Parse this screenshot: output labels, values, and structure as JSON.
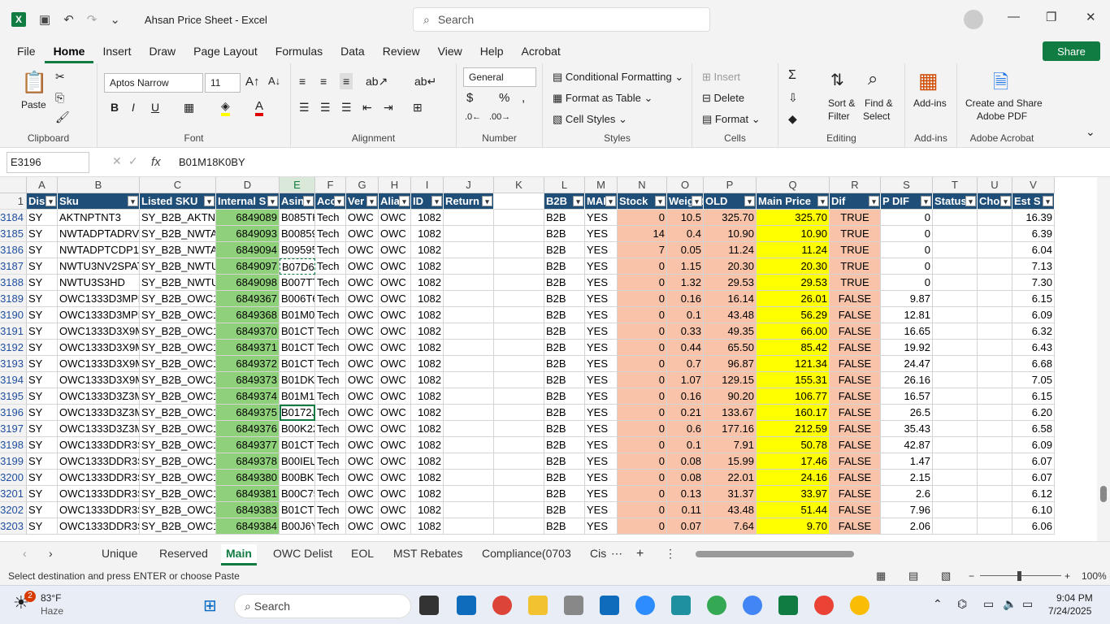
{
  "titlebar": {
    "app_icon": "X",
    "doc_title": "Ahsan Price Sheet  -  Excel",
    "search_placeholder": "Search"
  },
  "menus": [
    "File",
    "Home",
    "Insert",
    "Draw",
    "Page Layout",
    "Formulas",
    "Data",
    "Review",
    "View",
    "Help",
    "Acrobat"
  ],
  "share_label": "Share",
  "ribbon": {
    "clipboard": {
      "label": "Clipboard",
      "paste": "Paste"
    },
    "font": {
      "label": "Font",
      "family": "Aptos Narrow",
      "size": "11"
    },
    "alignment": {
      "label": "Alignment"
    },
    "number": {
      "label": "Number",
      "format": "General"
    },
    "styles": {
      "label": "Styles",
      "cond": "Conditional Formatting",
      "table": "Format as Table",
      "cell": "Cell Styles"
    },
    "cells": {
      "label": "Cells",
      "insert": "Insert",
      "delete": "Delete",
      "format": "Format"
    },
    "editing": {
      "label": "Editing",
      "sort": "Sort &",
      "sort2": "Filter",
      "find": "Find &",
      "find2": "Select"
    },
    "addins": {
      "label": "Add-ins",
      "btn": "Add-ins"
    },
    "acrobat": {
      "label": "Adobe Acrobat",
      "btn1": "Create and Share",
      "btn2": "Adobe PDF"
    }
  },
  "formula": {
    "namebox": "E3196",
    "content": "B01M18K0BY"
  },
  "columns": [
    "A",
    "B",
    "C",
    "D",
    "E",
    "F",
    "G",
    "H",
    "I",
    "J",
    "K",
    "L",
    "M",
    "N",
    "O",
    "P",
    "Q",
    "R",
    "S",
    "T",
    "U",
    "V"
  ],
  "headers": [
    "Dis",
    "Sku",
    "Listed SKU",
    "Internal S",
    "Asin",
    "Acc",
    "Ver",
    "Alia",
    "ID",
    "Return",
    "",
    "B2B",
    "MAP",
    "Stock",
    "Weight",
    "OLD",
    "Main Price",
    "Dif",
    "P DIF",
    "Status",
    "Cho",
    "Est S"
  ],
  "rows": [
    {
      "n": "3184",
      "a": "SY",
      "b": "AKTNPTNT3",
      "c": "SY_B2B_AKTNP",
      "d": "6849089",
      "e": "B085TH",
      "f": "Tech",
      "g": "OWC",
      "h": "OWC",
      "i": "1082",
      "l": "B2B",
      "m": "YES",
      "nn": "0",
      "o": "10.5",
      "p": "325.70",
      "q": "325.70",
      "r": "TRUE",
      "s": "0",
      "v": "16.39"
    },
    {
      "n": "3185",
      "a": "SY",
      "b": "NWTADPTADRV",
      "c": "SY_B2B_NWTAD",
      "d": "6849093",
      "e": "B00859",
      "f": "Tech",
      "g": "OWC",
      "h": "OWC",
      "i": "1082",
      "l": "B2B",
      "m": "YES",
      "nn": "14",
      "o": "0.4",
      "p": "10.90",
      "q": "10.90",
      "r": "TRUE",
      "s": "0",
      "v": "6.39"
    },
    {
      "n": "3186",
      "a": "SY",
      "b": "NWTADPTCDP14",
      "c": "SY_B2B_NWTAD",
      "d": "6849094",
      "e": "B09595",
      "f": "Tech",
      "g": "OWC",
      "h": "OWC",
      "i": "1082",
      "l": "B2B",
      "m": "YES",
      "nn": "7",
      "o": "0.05",
      "p": "11.24",
      "q": "11.24",
      "r": "TRUE",
      "s": "0",
      "v": "6.04"
    },
    {
      "n": "3187",
      "a": "SY",
      "b": "NWTU3NV2SPAT",
      "c": "SY_B2B_NWTU3",
      "d": "6849097",
      "e": "B07D62",
      "f": "Tech",
      "g": "OWC",
      "h": "OWC",
      "i": "1082",
      "l": "B2B",
      "m": "YES",
      "nn": "0",
      "o": "1.15",
      "p": "20.30",
      "q": "20.30",
      "r": "TRUE",
      "s": "0",
      "v": "7.13"
    },
    {
      "n": "3188",
      "a": "SY",
      "b": "NWTU3S3HD",
      "c": "SY_B2B_NWTU3",
      "d": "6849098",
      "e": "B007TT",
      "f": "Tech",
      "g": "OWC",
      "h": "OWC",
      "i": "1082",
      "l": "B2B",
      "m": "YES",
      "nn": "0",
      "o": "1.32",
      "p": "29.53",
      "q": "29.53",
      "r": "TRUE",
      "s": "0",
      "v": "7.30"
    },
    {
      "n": "3189",
      "a": "SY",
      "b": "OWC1333D3MPE",
      "c": "SY_B2B_OWC13",
      "d": "6849367",
      "e": "B006T6",
      "f": "Tech",
      "g": "OWC",
      "h": "OWC",
      "i": "1082",
      "l": "B2B",
      "m": "YES",
      "nn": "0",
      "o": "0.16",
      "p": "16.14",
      "q": "26.01",
      "r": "FALSE",
      "s": "9.87",
      "v": "6.15"
    },
    {
      "n": "3190",
      "a": "SY",
      "b": "OWC1333D3MPE",
      "c": "SY_B2B_OWC13",
      "d": "6849368",
      "e": "B01M0",
      "f": "Tech",
      "g": "OWC",
      "h": "OWC",
      "i": "1082",
      "l": "B2B",
      "m": "YES",
      "nn": "0",
      "o": "0.1",
      "p": "43.48",
      "q": "56.29",
      "r": "FALSE",
      "s": "12.81",
      "v": "6.09"
    },
    {
      "n": "3191",
      "a": "SY",
      "b": "OWC1333D3X9M",
      "c": "SY_B2B_OWC13",
      "d": "6849370",
      "e": "B01CT0",
      "f": "Tech",
      "g": "OWC",
      "h": "OWC",
      "i": "1082",
      "l": "B2B",
      "m": "YES",
      "nn": "0",
      "o": "0.33",
      "p": "49.35",
      "q": "66.00",
      "r": "FALSE",
      "s": "16.65",
      "v": "6.32"
    },
    {
      "n": "3192",
      "a": "SY",
      "b": "OWC1333D3X9M",
      "c": "SY_B2B_OWC13",
      "d": "6849371",
      "e": "B01CT0",
      "f": "Tech",
      "g": "OWC",
      "h": "OWC",
      "i": "1082",
      "l": "B2B",
      "m": "YES",
      "nn": "0",
      "o": "0.44",
      "p": "65.50",
      "q": "85.42",
      "r": "FALSE",
      "s": "19.92",
      "v": "6.43"
    },
    {
      "n": "3193",
      "a": "SY",
      "b": "OWC1333D3X9M",
      "c": "SY_B2B_OWC13",
      "d": "6849372",
      "e": "B01CTE",
      "f": "Tech",
      "g": "OWC",
      "h": "OWC",
      "i": "1082",
      "l": "B2B",
      "m": "YES",
      "nn": "0",
      "o": "0.7",
      "p": "96.87",
      "q": "121.34",
      "r": "FALSE",
      "s": "24.47",
      "v": "6.68"
    },
    {
      "n": "3194",
      "a": "SY",
      "b": "OWC1333D3X9M",
      "c": "SY_B2B_OWC13",
      "d": "6849373",
      "e": "B01DK5",
      "f": "Tech",
      "g": "OWC",
      "h": "OWC",
      "i": "1082",
      "l": "B2B",
      "m": "YES",
      "nn": "0",
      "o": "1.07",
      "p": "129.15",
      "q": "155.31",
      "r": "FALSE",
      "s": "26.16",
      "v": "7.05"
    },
    {
      "n": "3195",
      "a": "SY",
      "b": "OWC1333D3Z3M",
      "c": "SY_B2B_OWC13",
      "d": "6849374",
      "e": "B01M1",
      "f": "Tech",
      "g": "OWC",
      "h": "OWC",
      "i": "1082",
      "l": "B2B",
      "m": "YES",
      "nn": "0",
      "o": "0.16",
      "p": "90.20",
      "q": "106.77",
      "r": "FALSE",
      "s": "16.57",
      "v": "6.15"
    },
    {
      "n": "3196",
      "a": "SY",
      "b": "OWC1333D3Z3M",
      "c": "SY_B2B_OWC13",
      "d": "6849375",
      "e": "B0172J",
      "f": "Tech",
      "g": "OWC",
      "h": "OWC",
      "i": "1082",
      "l": "B2B",
      "m": "YES",
      "nn": "0",
      "o": "0.21",
      "p": "133.67",
      "q": "160.17",
      "r": "FALSE",
      "s": "26.5",
      "v": "6.20"
    },
    {
      "n": "3197",
      "a": "SY",
      "b": "OWC1333D3Z3M",
      "c": "SY_B2B_OWC13",
      "d": "6849376",
      "e": "B00K22",
      "f": "Tech",
      "g": "OWC",
      "h": "OWC",
      "i": "1082",
      "l": "B2B",
      "m": "YES",
      "nn": "0",
      "o": "0.6",
      "p": "177.16",
      "q": "212.59",
      "r": "FALSE",
      "s": "35.43",
      "v": "6.58"
    },
    {
      "n": "3198",
      "a": "SY",
      "b": "OWC1333DDR3S",
      "c": "SY_B2B_OWC13",
      "d": "6849377",
      "e": "B01CTE",
      "f": "Tech",
      "g": "OWC",
      "h": "OWC",
      "i": "1082",
      "l": "B2B",
      "m": "YES",
      "nn": "0",
      "o": "0.1",
      "p": "7.91",
      "q": "50.78",
      "r": "FALSE",
      "s": "42.87",
      "v": "6.09"
    },
    {
      "n": "3199",
      "a": "SY",
      "b": "OWC1333DDR3S",
      "c": "SY_B2B_OWC13",
      "d": "6849378",
      "e": "B00IEL",
      "f": "Tech",
      "g": "OWC",
      "h": "OWC",
      "i": "1082",
      "l": "B2B",
      "m": "YES",
      "nn": "0",
      "o": "0.08",
      "p": "15.99",
      "q": "17.46",
      "r": "FALSE",
      "s": "1.47",
      "v": "6.07"
    },
    {
      "n": "3200",
      "a": "SY",
      "b": "OWC1333DDR3S",
      "c": "SY_B2B_OWC13",
      "d": "6849380",
      "e": "B00BK",
      "f": "Tech",
      "g": "OWC",
      "h": "OWC",
      "i": "1082",
      "l": "B2B",
      "m": "YES",
      "nn": "0",
      "o": "0.08",
      "p": "22.01",
      "q": "24.16",
      "r": "FALSE",
      "s": "2.15",
      "v": "6.07"
    },
    {
      "n": "3201",
      "a": "SY",
      "b": "OWC1333DDR3S",
      "c": "SY_B2B_OWC13",
      "d": "6849381",
      "e": "B00C75",
      "f": "Tech",
      "g": "OWC",
      "h": "OWC",
      "i": "1082",
      "l": "B2B",
      "m": "YES",
      "nn": "0",
      "o": "0.13",
      "p": "31.37",
      "q": "33.97",
      "r": "FALSE",
      "s": "2.6",
      "v": "6.12"
    },
    {
      "n": "3202",
      "a": "SY",
      "b": "OWC1333DDR3S",
      "c": "SY_B2B_OWC13",
      "d": "6849383",
      "e": "B01CTE",
      "f": "Tech",
      "g": "OWC",
      "h": "OWC",
      "i": "1082",
      "l": "B2B",
      "m": "YES",
      "nn": "0",
      "o": "0.11",
      "p": "43.48",
      "q": "51.44",
      "r": "FALSE",
      "s": "7.96",
      "v": "6.10"
    },
    {
      "n": "3203",
      "a": "SY",
      "b": "OWC1333DDR3S",
      "c": "SY_B2B_OWC13",
      "d": "6849384",
      "e": "B00J6Y",
      "f": "Tech",
      "g": "OWC",
      "h": "OWC",
      "i": "1082",
      "l": "B2B",
      "m": "YES",
      "nn": "0",
      "o": "0.07",
      "p": "7.64",
      "q": "9.70",
      "r": "FALSE",
      "s": "2.06",
      "v": "6.06"
    }
  ],
  "tabs": [
    "Unique",
    "Reserved",
    "Main",
    "OWC Delist",
    "EOL",
    "MST Rebates",
    "Compliance(0703",
    "Cis"
  ],
  "active_tab": "Main",
  "status": {
    "text": "Select destination and press ENTER or choose Paste",
    "zoom": "100%"
  },
  "taskbar": {
    "weather_temp": "83°F",
    "weather_desc": "Haze",
    "weather_badge": "2",
    "search": "Search",
    "time": "9:04 PM",
    "date": "7/24/2025"
  },
  "colors": {
    "header_blue": "#1f4e79",
    "green": "#8fd17a",
    "salmon": "#f8c3a8",
    "yellow": "#ffff00",
    "accent": "#107c41"
  }
}
